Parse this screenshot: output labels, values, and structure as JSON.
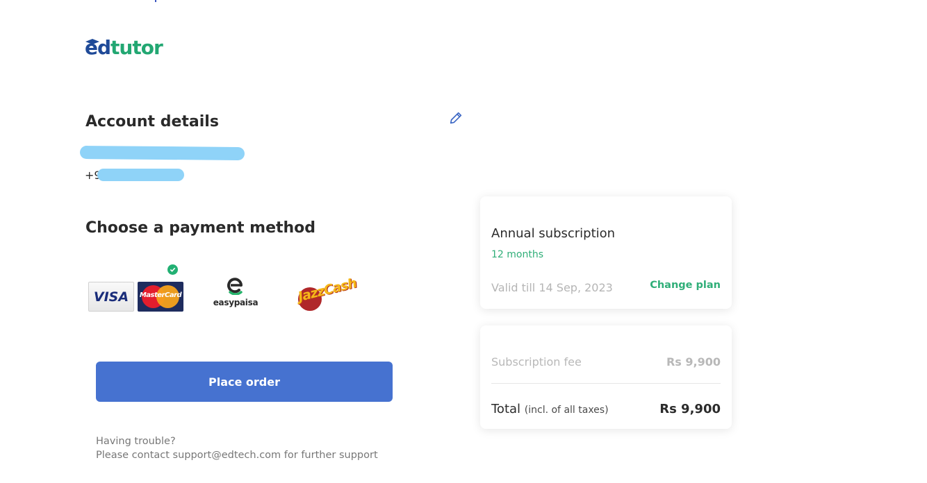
{
  "logo": {
    "part1": "ed",
    "part2": "tutor",
    "color_primary": "#1f4a98",
    "color_secondary": "#22a772"
  },
  "account": {
    "title": "Account details",
    "phone_prefix": "+9",
    "edit_icon": "pencil-icon"
  },
  "payment": {
    "title": "Choose a payment method",
    "selected": "card",
    "methods": [
      {
        "id": "card",
        "visa_label": "VISA",
        "mastercard_label": "MasterCard"
      },
      {
        "id": "easypaisa",
        "label": "easypaisa"
      },
      {
        "id": "jazzcash",
        "label": "JazzCash",
        "label_part1": "Jazz",
        "label_part2": "Cash"
      }
    ]
  },
  "actions": {
    "place_order": "Place order"
  },
  "help": {
    "line1": "Having trouble?",
    "line2": "Please contact support@edtech.com for further support"
  },
  "plan": {
    "title": "Annual subscription",
    "period": "12 months",
    "valid": "Valid till 14 Sep, 2023",
    "change": "Change plan"
  },
  "summary": {
    "fee_label": "Subscription fee",
    "fee_value": "Rs 9,900",
    "total_label": "Total",
    "total_note": "(incl. of all taxes)",
    "total_value": "Rs 9,900"
  },
  "colors": {
    "accent_blue": "#4672d0",
    "accent_green": "#2fae78"
  }
}
